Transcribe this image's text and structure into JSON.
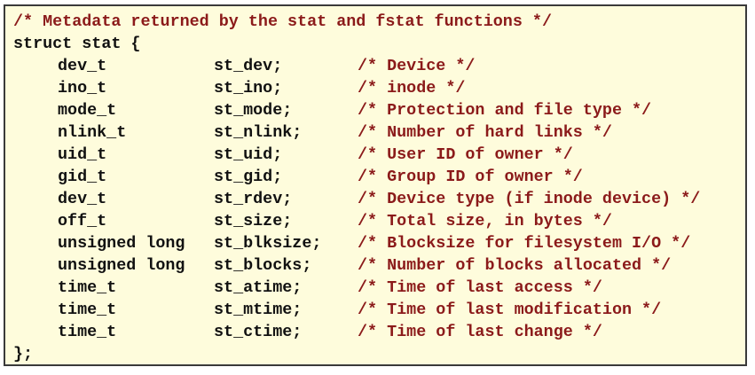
{
  "code": {
    "header_comment": "/* Metadata returned by the stat and fstat functions */",
    "struct_open": "struct stat {",
    "fields": [
      {
        "type": "dev_t",
        "name": "st_dev;",
        "comment": "/* Device */"
      },
      {
        "type": "ino_t",
        "name": "st_ino;",
        "comment": "/* inode */"
      },
      {
        "type": "mode_t",
        "name": "st_mode;",
        "comment": "/* Protection and file type */"
      },
      {
        "type": "nlink_t",
        "name": "st_nlink;",
        "comment": "/* Number of hard links */"
      },
      {
        "type": "uid_t",
        "name": "st_uid;",
        "comment": "/* User ID of owner */"
      },
      {
        "type": "gid_t",
        "name": "st_gid;",
        "comment": "/* Group ID of owner */"
      },
      {
        "type": "dev_t",
        "name": "st_rdev;",
        "comment": "/* Device type (if inode device) */"
      },
      {
        "type": "off_t",
        "name": "st_size;",
        "comment": "/* Total size, in bytes */"
      },
      {
        "type": "unsigned long",
        "name": "st_blksize;",
        "comment": "/* Blocksize for filesystem I/O */"
      },
      {
        "type": "unsigned long",
        "name": "st_blocks;",
        "comment": "/* Number of blocks allocated */"
      },
      {
        "type": "time_t",
        "name": "st_atime;",
        "comment": "/* Time of last access */"
      },
      {
        "type": "time_t",
        "name": "st_mtime;",
        "comment": "/* Time of last modification */"
      },
      {
        "type": "time_t",
        "name": "st_ctime;",
        "comment": "/* Time of last change */"
      }
    ],
    "struct_close": "};"
  },
  "colors": {
    "background": "#fefcdc",
    "comment": "#8b1a1a",
    "code": "#111111",
    "border": "#3a3a3a"
  }
}
